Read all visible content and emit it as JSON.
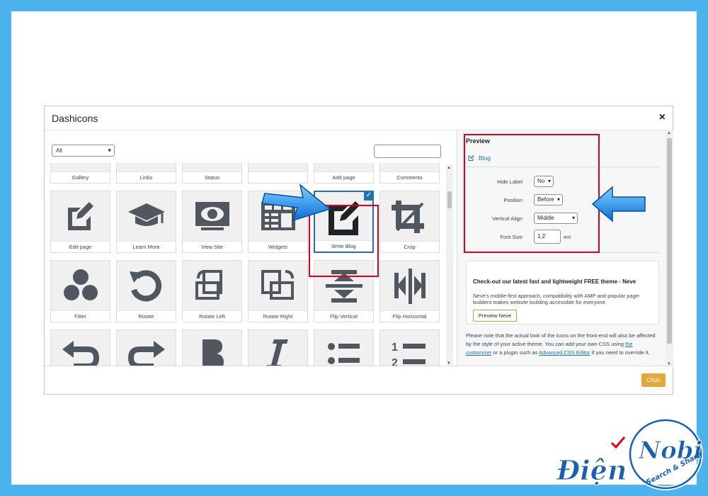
{
  "modal": {
    "title": "Dashicons",
    "close_glyph": "×",
    "filter_value": "All",
    "filter_chevron": "▾",
    "choose_label": "Chọn"
  },
  "icons": [
    {
      "label": "Gallery",
      "icon": "format-gallery-icon"
    },
    {
      "label": "Links",
      "icon": "admin-links-icon"
    },
    {
      "label": "Status",
      "icon": "format-status-icon"
    },
    {
      "label": "",
      "icon": "format-chat-icon"
    },
    {
      "label": "Add page",
      "icon": "welcome-add-page-icon"
    },
    {
      "label": "Comments",
      "icon": "welcome-comments-icon"
    },
    {
      "label": "Edit page",
      "icon": "edit-page-icon"
    },
    {
      "label": "Learn More",
      "icon": "welcome-learn-more-icon"
    },
    {
      "label": "View Site",
      "icon": "welcome-view-site-icon"
    },
    {
      "label": "Widgets",
      "icon": "welcome-widgets-menus-icon"
    },
    {
      "label": "Write Blog",
      "icon": "welcome-write-blog-icon",
      "selected": true
    },
    {
      "label": "Crop",
      "icon": "image-crop-icon"
    },
    {
      "label": "Filter",
      "icon": "image-filter-icon"
    },
    {
      "label": "Rotate",
      "icon": "image-rotate-icon"
    },
    {
      "label": "Rotate Left",
      "icon": "image-rotate-left-icon"
    },
    {
      "label": "Rotate Right",
      "icon": "image-rotate-right-icon"
    },
    {
      "label": "Flip Vertical",
      "icon": "image-flip-vertical-icon"
    },
    {
      "label": "Flip Horizontal",
      "icon": "image-flip-horizontal-icon"
    },
    {
      "label": "",
      "icon": "undo-icon"
    },
    {
      "label": "",
      "icon": "redo-icon"
    },
    {
      "label": "",
      "icon": "editor-bold-icon"
    },
    {
      "label": "",
      "icon": "editor-italic-icon"
    },
    {
      "label": "",
      "icon": "editor-ul-icon"
    },
    {
      "label": "",
      "icon": "editor-ol-icon"
    }
  ],
  "preview": {
    "title": "Preview",
    "sample_text": "Blog",
    "options": {
      "hide_label": {
        "label": "Hide Label",
        "value": "No"
      },
      "position": {
        "label": "Position",
        "value": "Before"
      },
      "vertical_align": {
        "label": "Vertical Align",
        "value": "Middle"
      },
      "font_size": {
        "label": "Font Size",
        "value": "1,2",
        "unit": "em"
      }
    }
  },
  "promo": {
    "title": "Check-out our latest fast and lightweight FREE theme - Neve",
    "text": "Neve's mobile-first approach, compatibility with AMP and popular page-builders makes website building accessible for everyone.",
    "button": "Preview Neve"
  },
  "note": {
    "part1": "Please note that the actual look of the icons on the front-end will also be affected by the style of your active theme. You can add your own CSS using ",
    "link1": "the customizer",
    "part2": " or a plugin such as ",
    "link2": "Advanced CSS Editor",
    "part3": " if you need to override it."
  },
  "logo": {
    "word1": "Điện",
    "word2": "Nobi",
    "tagline": "Search & Share"
  },
  "colors": {
    "background": "#4db3ef",
    "icon": "#50575e",
    "icon_selected": "#1d2327",
    "accent": "#2271b1",
    "highlight": "#e3001b",
    "button": "#e4a73a",
    "logo": "#1b5fb0"
  }
}
